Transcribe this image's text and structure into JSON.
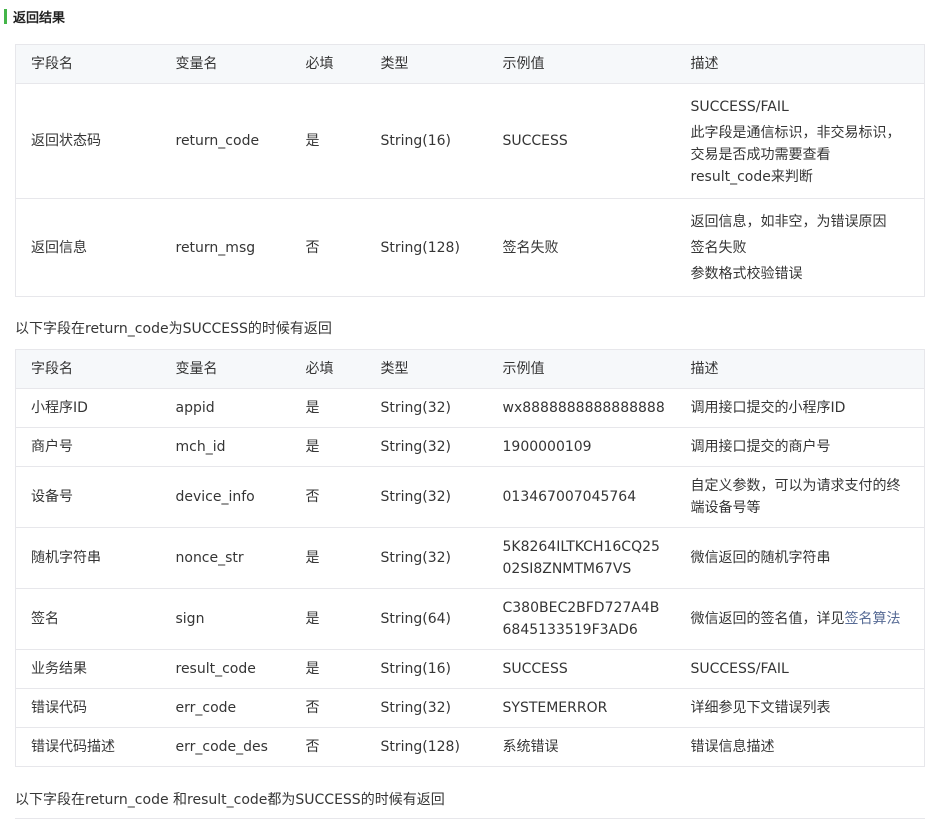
{
  "section": {
    "title": "返回结果"
  },
  "headers": [
    "字段名",
    "变量名",
    "必填",
    "类型",
    "示例值",
    "描述"
  ],
  "table1": {
    "rows": [
      {
        "name": "返回状态码",
        "var": "return_code",
        "required": "是",
        "type": "String(16)",
        "example": "SUCCESS",
        "desc1": "SUCCESS/FAIL",
        "desc2": "此字段是通信标识，非交易标识，交易是否成功需要查看result_code来判断"
      },
      {
        "name": "返回信息",
        "var": "return_msg",
        "required": "否",
        "type": "String(128)",
        "example": "签名失败",
        "desc1": "返回信息，如非空，为错误原因",
        "desc2": "签名失败",
        "desc3": "参数格式校验错误"
      }
    ]
  },
  "note1": "以下字段在return_code为SUCCESS的时候有返回",
  "table2": {
    "rows": [
      {
        "name": "小程序ID",
        "var": "appid",
        "required": "是",
        "type": "String(32)",
        "example": "wx8888888888888888",
        "desc": "调用接口提交的小程序ID"
      },
      {
        "name": "商户号",
        "var": "mch_id",
        "required": "是",
        "type": "String(32)",
        "example": "1900000109",
        "desc": "调用接口提交的商户号"
      },
      {
        "name": "设备号",
        "var": "device_info",
        "required": "否",
        "type": "String(32)",
        "example": "013467007045764",
        "desc": "自定义参数，可以为请求支付的终端设备号等"
      },
      {
        "name": "随机字符串",
        "var": "nonce_str",
        "required": "是",
        "type": "String(32)",
        "example": "5K8264ILTKCH16CQ2502SI8ZNMTM67VS",
        "desc": "微信返回的随机字符串"
      },
      {
        "name": "签名",
        "var": "sign",
        "required": "是",
        "type": "String(64)",
        "example": "C380BEC2BFD727A4B6845133519F3AD6",
        "desc": "微信返回的签名值，详见",
        "desc_link": "签名算法"
      },
      {
        "name": "业务结果",
        "var": "result_code",
        "required": "是",
        "type": "String(16)",
        "example": "SUCCESS",
        "desc": "SUCCESS/FAIL"
      },
      {
        "name": "错误代码",
        "var": "err_code",
        "required": "否",
        "type": "String(32)",
        "example": "SYSTEMERROR",
        "desc": "详细参见下文错误列表"
      },
      {
        "name": "错误代码描述",
        "var": "err_code_des",
        "required": "否",
        "type": "String(128)",
        "example": "系统错误",
        "desc": "错误信息描述"
      }
    ]
  },
  "note2": "以下字段在return_code 和result_code都为SUCCESS的时候有返回",
  "colors": {
    "accent": "#44b549",
    "link": "#576b95",
    "header_bg": "#f6f8fa",
    "border": "#e7e7eb"
  }
}
